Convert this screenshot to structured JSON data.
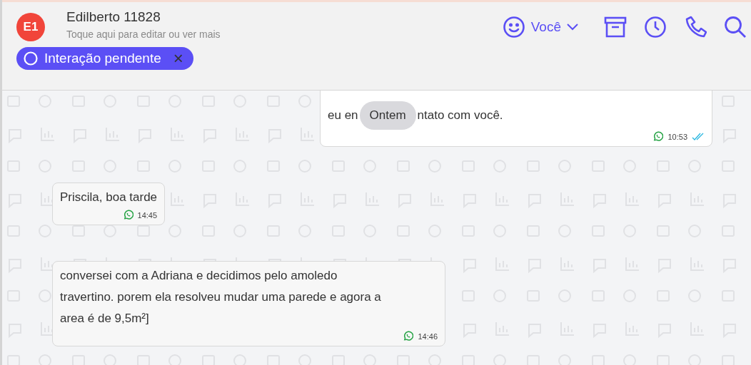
{
  "contact": {
    "avatar": "E1",
    "name": "Edilberto 11828",
    "subtitle": "Toque aqui para editar ou ver mais"
  },
  "status_chip": {
    "label": "Interação pendente",
    "close": "×"
  },
  "agent": {
    "label": "Você"
  },
  "date_separator": "Ontem",
  "messages": [
    {
      "kind": "outgoing",
      "before_date": "eu en",
      "after_date": "ntato com você.",
      "time": "10:53",
      "read": true
    },
    {
      "kind": "incoming",
      "lines": [
        "Priscila, boa tarde"
      ],
      "time": "14:45"
    },
    {
      "kind": "incoming",
      "lines": [
        "conversei com a Adriana e decidimos pelo amoledo",
        "travertino. porem ela resolveu mudar uma parede e agora a",
        "area é de 9,5m²]"
      ],
      "time": "14:46"
    }
  ]
}
